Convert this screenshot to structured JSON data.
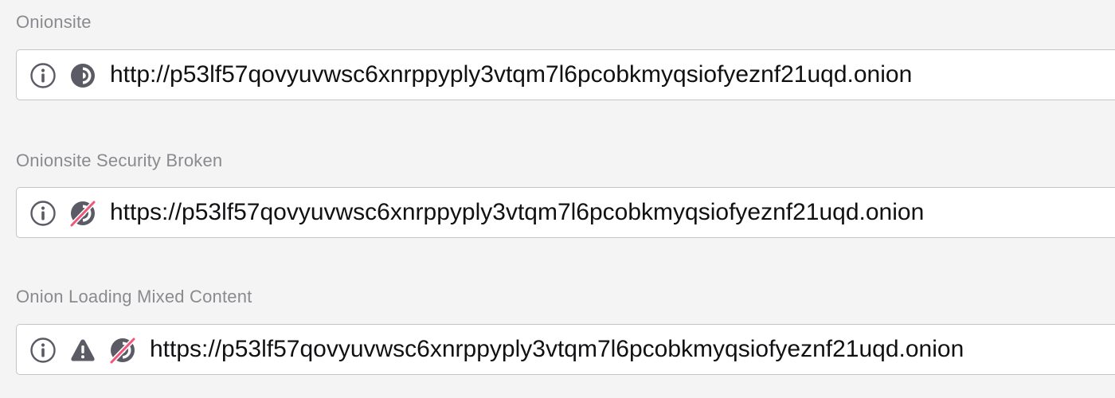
{
  "sections": [
    {
      "label": "Onionsite",
      "url": "http://p53lf57qovyuvwsc6xnrppyply3vtqm7l6pcobkmyqsiofyeznf21uqd.onion",
      "icons": [
        "info-icon",
        "onion-icon"
      ]
    },
    {
      "label": "Onionsite Security Broken",
      "url": "https://p53lf57qovyuvwsc6xnrppyply3vtqm7l6pcobkmyqsiofyeznf21uqd.onion",
      "icons": [
        "info-icon",
        "onion-broken-icon"
      ]
    },
    {
      "label": "Onion Loading Mixed Content",
      "url": "https://p53lf57qovyuvwsc6xnrppyply3vtqm7l6pcobkmyqsiofyeznf21uqd.onion",
      "icons": [
        "info-icon",
        "warning-icon",
        "onion-broken-icon"
      ]
    }
  ],
  "colors": {
    "background": "#f4f4f4",
    "label": "#8a8a8f",
    "icon": "#5b5b66",
    "broken_slash": "#f0577a",
    "url_text": "#111113"
  }
}
